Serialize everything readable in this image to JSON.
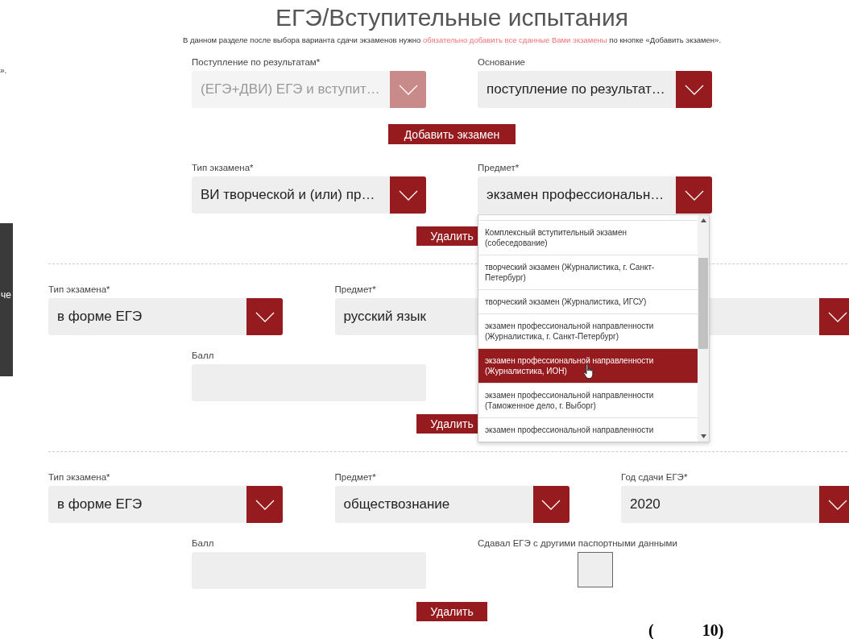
{
  "background": {
    "edge_text": "».",
    "side_panel_text": "че"
  },
  "title": "ЕГЭ/Вступительные испытания",
  "notice": {
    "before": "В данном разделе после выбора варианта сдачи экзаменов нужно",
    "highlight": "обязательно добавить все сданные Вами экзамены",
    "after": "по кнопке «Добавить экзамен»."
  },
  "admission": [
    {
      "label": "Поступление по результатам*",
      "value": "(ЕГЭ+ДВИ) ЕГЭ и вступит…",
      "disabled": true
    },
    {
      "label": "Основание",
      "value": "поступление по результат…",
      "disabled": false
    }
  ],
  "add_exam_button": "Добавить экзамен",
  "exams": [
    {
      "fields": [
        {
          "kind": "select",
          "label": "Тип экзамена*",
          "value": "ВИ творческой и (или) пр…"
        },
        {
          "kind": "select",
          "label": "Предмет*",
          "value": "экзамен профессиональн…",
          "options": [
            {
              "text": "Комплексный вступительный экзамен (собеседование)",
              "selected": false
            },
            {
              "text": "творческий экзамен (Журналистика, г. Санкт-Петербург)",
              "selected": false
            },
            {
              "text": "творческий экзамен (Журналистика, ИГСУ)",
              "selected": false
            },
            {
              "text": "экзамен профессиональной направленности (Журналистика, г. Санкт-Петербург)",
              "selected": false
            },
            {
              "text": "экзамен профессиональной направленности (Журналистика, ИОН)",
              "selected": true
            },
            {
              "text": "экзамен профессиональной направленности (Таможенное дело, г. Выборг)",
              "selected": false
            },
            {
              "text": "экзамен профессиональной направленности",
              "selected": false
            }
          ]
        }
      ],
      "delete_button": "Удалить"
    },
    {
      "fields": [
        {
          "kind": "select",
          "label": "Тип экзамена*",
          "value": "в форме ЕГЭ"
        },
        {
          "kind": "covered",
          "label": "Предмет*",
          "value": "русский язык"
        },
        {
          "kind": "select"
        }
      ],
      "score": {
        "label": "Балл"
      },
      "delete_button": "Удалить"
    },
    {
      "fields": [
        {
          "kind": "select",
          "label": "Тип экзамена*",
          "value": "в форме ЕГЭ"
        },
        {
          "kind": "select",
          "label": "Предмет*",
          "value": "обществознание"
        },
        {
          "kind": "select",
          "label": "Год сдачи ЕГЭ*",
          "value": "2020"
        }
      ],
      "score": {
        "label": "Балл"
      },
      "other_passport": {
        "label": "Сдавал ЕГЭ с другими паспортными данными",
        "checked": false
      },
      "delete_button": "Удалить"
    }
  ],
  "page_number": [
    "(",
    "10)"
  ]
}
